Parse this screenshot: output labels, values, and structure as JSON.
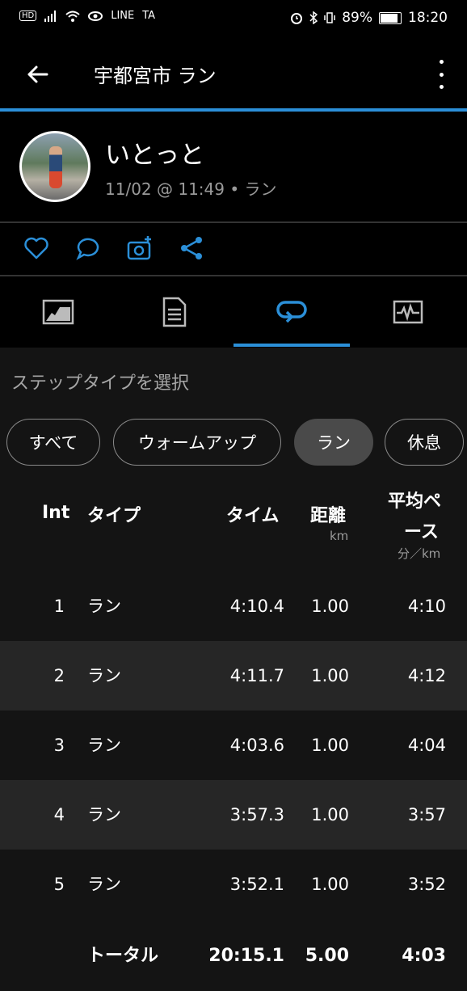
{
  "status": {
    "hd": "HD",
    "line": "LINE",
    "ta": "TA",
    "battery": "89%",
    "time": "18:20"
  },
  "appbar": {
    "title": "宇都宮市 ラン"
  },
  "profile": {
    "name": "いとっと",
    "meta": "11/02 @ 11:49 • ラン"
  },
  "step_label": "ステップタイプを選択",
  "chips": [
    {
      "label": "すべて",
      "selected": false
    },
    {
      "label": "ウォームアップ",
      "selected": false
    },
    {
      "label": "ラン",
      "selected": true
    },
    {
      "label": "休息",
      "selected": false
    }
  ],
  "table": {
    "headers": {
      "int": "Int",
      "type": "タイプ",
      "time": "タイム",
      "distance": "距離",
      "distance_unit": "km",
      "pace_line1": "平均ペ",
      "pace_line2": "ース",
      "pace_unit": "分／km"
    },
    "rows": [
      {
        "int": "1",
        "type": "ラン",
        "time": "4:10.4",
        "distance": "1.00",
        "pace": "4:10"
      },
      {
        "int": "2",
        "type": "ラン",
        "time": "4:11.7",
        "distance": "1.00",
        "pace": "4:12"
      },
      {
        "int": "3",
        "type": "ラン",
        "time": "4:03.6",
        "distance": "1.00",
        "pace": "4:04"
      },
      {
        "int": "4",
        "type": "ラン",
        "time": "3:57.3",
        "distance": "1.00",
        "pace": "3:57"
      },
      {
        "int": "5",
        "type": "ラン",
        "time": "3:52.1",
        "distance": "1.00",
        "pace": "3:52"
      }
    ],
    "total": {
      "label": "トータル",
      "time": "20:15.1",
      "distance": "5.00",
      "pace": "4:03"
    }
  },
  "colors": {
    "accent": "#2b8fd8",
    "background": "#141414",
    "alt_row": "#262626"
  }
}
